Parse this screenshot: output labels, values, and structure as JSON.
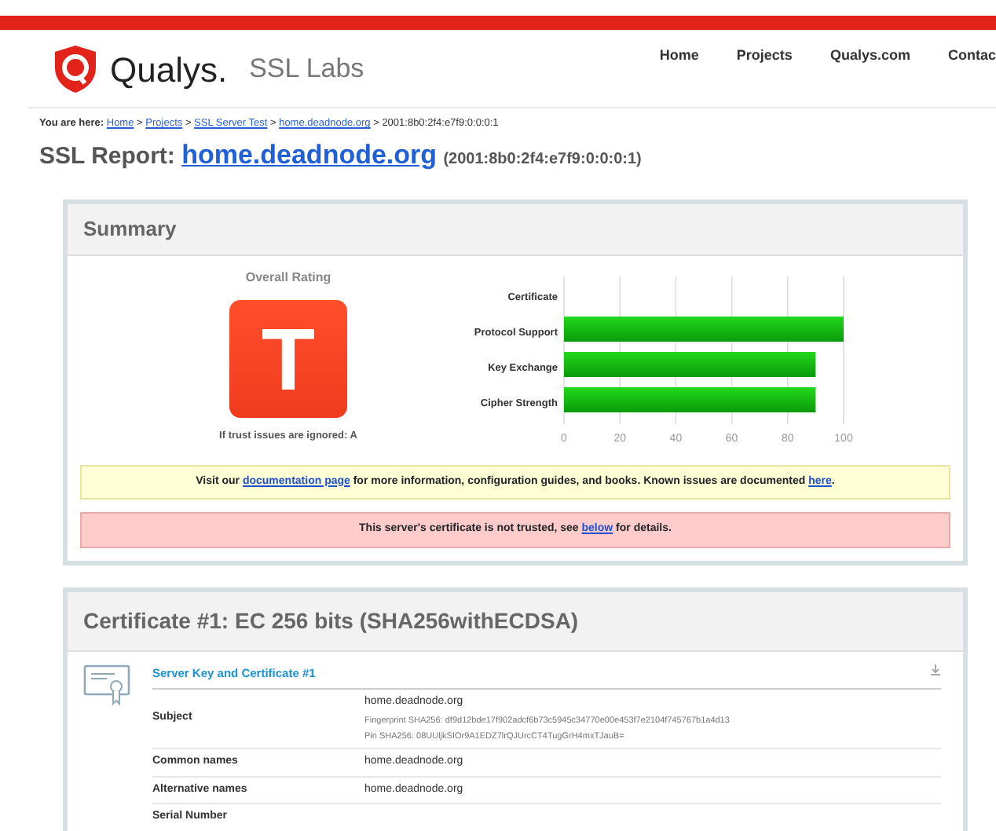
{
  "header": {
    "brand": "Qualys.",
    "product": "SSL Labs",
    "nav": [
      {
        "label": "Home"
      },
      {
        "label": "Projects"
      },
      {
        "label": "Qualys.com"
      },
      {
        "label": "Contac"
      }
    ]
  },
  "breadcrumb": {
    "prefix": "You are here:",
    "links": [
      "Home",
      "Projects",
      "SSL Server Test",
      "home.deadnode.org"
    ],
    "separator": ">",
    "current": "2001:8b0:2f4:e7f9:0:0:0:1"
  },
  "report": {
    "label": "SSL Report:",
    "host": "home.deadnode.org",
    "address": "(2001:8b0:2f4:e7f9:0:0:0:1)"
  },
  "summary": {
    "title": "Summary",
    "rating_label": "Overall Rating",
    "grade": "T",
    "ignored_note": "If trust issues are ignored: A",
    "chart_data": {
      "type": "bar",
      "orientation": "horizontal",
      "categories": [
        "Certificate",
        "Protocol Support",
        "Key Exchange",
        "Cipher Strength"
      ],
      "values": [
        0,
        100,
        90,
        90
      ],
      "xlim": [
        0,
        100
      ],
      "grid": true,
      "xticks": [
        0,
        20,
        40,
        60,
        80,
        100
      ]
    },
    "notices": [
      {
        "kind": "info",
        "parts": [
          {
            "text": "Visit our "
          },
          {
            "text": "documentation page",
            "link": true
          },
          {
            "text": " for more information, configuration guides, and books. Known issues are documented "
          },
          {
            "text": "here",
            "link": true
          },
          {
            "text": "."
          }
        ]
      },
      {
        "kind": "warning",
        "parts": [
          {
            "text": "This server's certificate is not trusted, see "
          },
          {
            "text": "below",
            "link": true
          },
          {
            "text": " for details."
          }
        ]
      }
    ]
  },
  "certificate": {
    "title": "Certificate #1: EC 256 bits (SHA256withECDSA)",
    "section": "Server Key and Certificate #1",
    "rows": [
      {
        "label": "Subject",
        "values": [
          "home.deadnode.org"
        ],
        "details": [
          "Fingerprint SHA256: df9d12bde17f902adcf6b73c5945c34770e00e453f7e2104f745767b1a4d13",
          "Pin SHA256: 08UUljkSIOr9A1EDZ7lrQJUrcCT4TugGrH4mxTJauB="
        ]
      },
      {
        "label": "Common names",
        "values": [
          "home.deadnode.org"
        ]
      },
      {
        "label": "Alternative names",
        "values": [
          "home.deadnode.org"
        ]
      },
      {
        "label": "Serial Number",
        "values": []
      }
    ]
  }
}
